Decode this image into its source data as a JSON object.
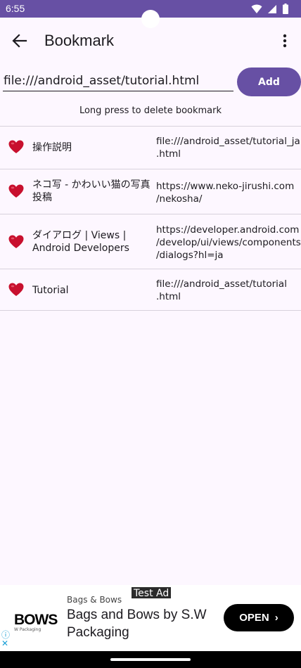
{
  "status_bar": {
    "time": "6:55"
  },
  "app_bar": {
    "title": "Bookmark"
  },
  "url_input": {
    "value": "file:///android_asset/tutorial.html"
  },
  "add_button": {
    "label": "Add"
  },
  "hint": "Long press to delete bookmark",
  "bookmarks": [
    {
      "title": "操作説明",
      "url": "file:///android_asset/tutorial_ja\n.html"
    },
    {
      "title": "ネコ写 - かわいい猫の写真投稿",
      "url": "https://www.neko-jirushi.com\n/nekosha/"
    },
    {
      "title": "ダイアログ  |  Views  |  Android Developers",
      "url": "https://developer.android.com\n/develop/ui/views/components\n/dialogs?hl=ja"
    },
    {
      "title": "Tutorial",
      "url": "file:///android_asset/tutorial\n.html"
    }
  ],
  "ad": {
    "badge": "Test Ad",
    "advertiser": "Bags & Bows",
    "headline": "Bags and Bows by S.W Packaging",
    "cta": "OPEN",
    "logo_text": "BOWS",
    "logo_subtext": "W Packaging"
  },
  "colors": {
    "primary": "#6750a4",
    "background": "#fdf7ff",
    "heart": "#c8102e"
  },
  "icons": [
    "back-arrow-icon",
    "more-vert-icon",
    "heart-icon",
    "wifi-icon",
    "signal-icon",
    "battery-icon",
    "info-icon",
    "close-icon",
    "chevron-right-icon"
  ]
}
